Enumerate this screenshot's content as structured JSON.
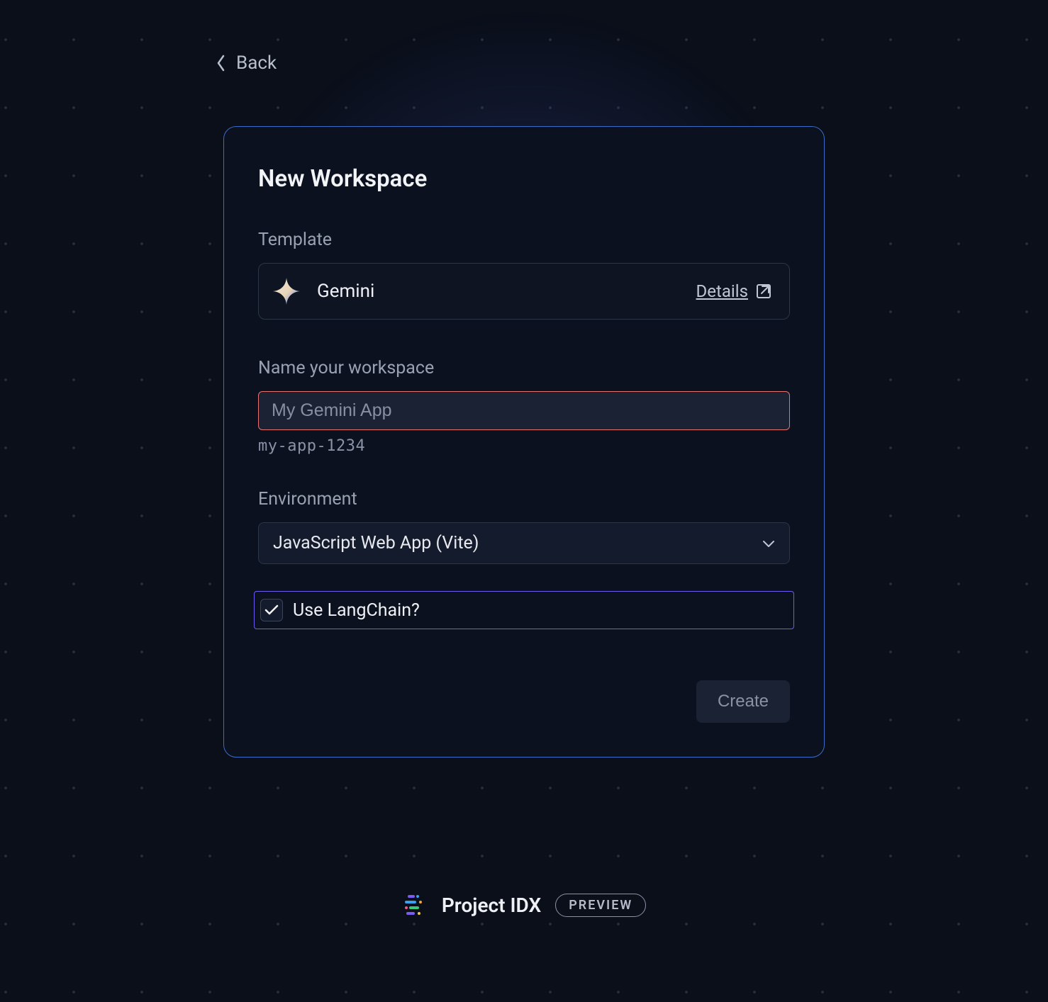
{
  "nav": {
    "back_label": "Back"
  },
  "card": {
    "title": "New Workspace",
    "template": {
      "section_label": "Template",
      "name": "Gemini",
      "details_label": "Details"
    },
    "workspace_name": {
      "section_label": "Name your workspace",
      "placeholder": "My Gemini App",
      "value": "",
      "slug": "my-app-1234"
    },
    "environment": {
      "section_label": "Environment",
      "selected": "JavaScript Web App (Vite)"
    },
    "langchain": {
      "label": "Use LangChain?",
      "checked": true
    },
    "actions": {
      "create_label": "Create"
    }
  },
  "footer": {
    "product_name": "Project IDX",
    "badge": "PREVIEW"
  }
}
